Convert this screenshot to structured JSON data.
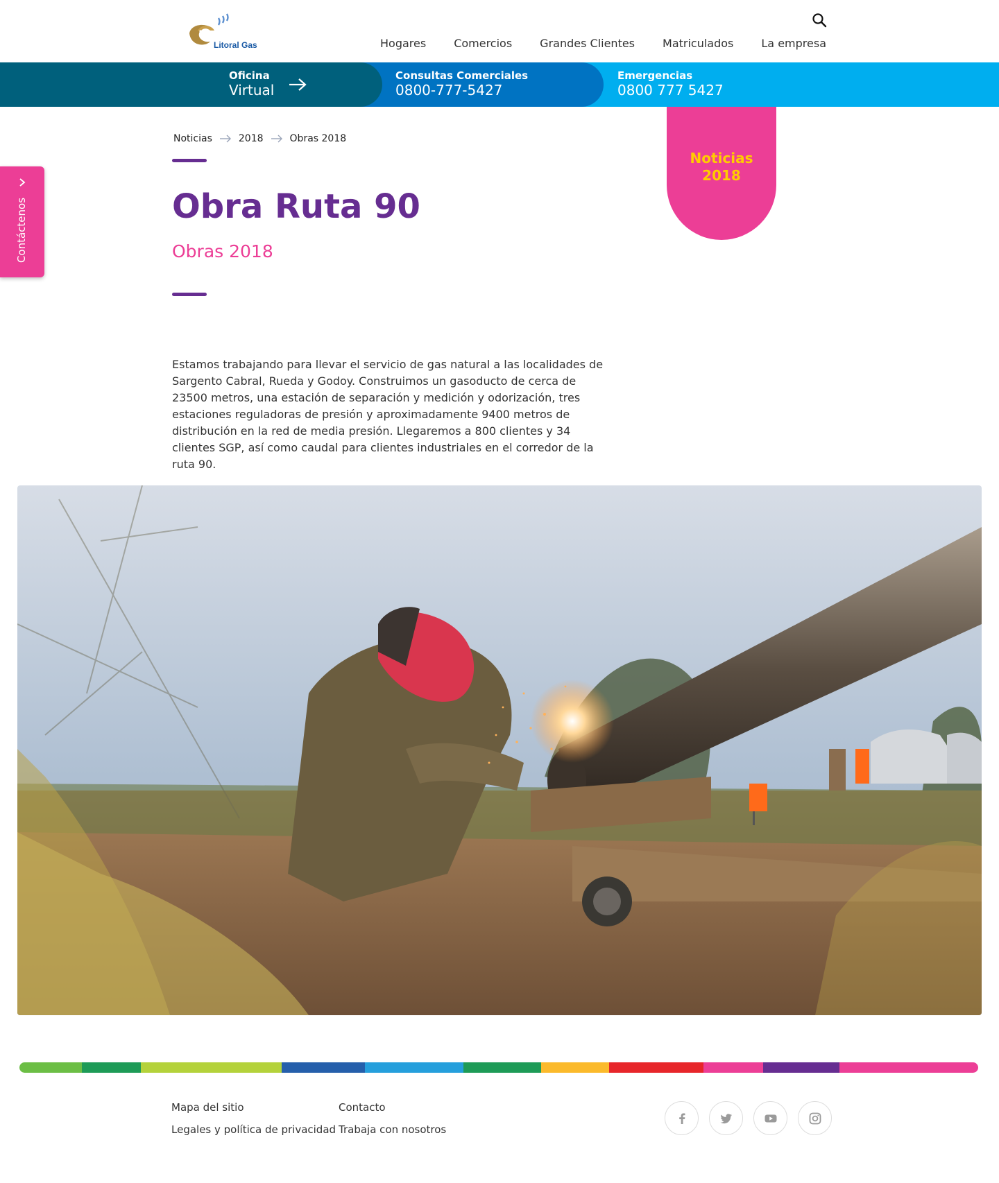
{
  "header": {
    "logo_text": "Litoral Gas",
    "nav": [
      "Hogares",
      "Comercios",
      "Grandes Clientes",
      "Matriculados",
      "La empresa"
    ]
  },
  "banner": {
    "oficina_label": "Oficina",
    "oficina_value": "Virtual",
    "consultas_label": "Consultas Comerciales",
    "consultas_value": "0800-777-5427",
    "emergencias_label": "Emergencias",
    "emergencias_value": "0800 777 5427"
  },
  "contact_tab": {
    "label": "Contáctenos"
  },
  "badge": {
    "text": "Noticias\n2018"
  },
  "breadcrumb": [
    "Noticias",
    "2018",
    "Obras 2018"
  ],
  "article": {
    "title": "Obra Ruta 90",
    "category": "Obras 2018",
    "body": "Estamos trabajando para llevar el servicio de gas natural a las localidades de Sargento Cabral, Rueda y Godoy. Construimos un gasoducto de cerca de 23500 metros, una estación de separación y medición y odorización, tres estaciones reguladoras de presión y aproximadamente 9400 metros de distribución en la red de media presión. Llegaremos a 800 clientes y 34 clientes SGP, así como caudal para clientes industriales en el corredor de la ruta 90."
  },
  "footer": {
    "col1": [
      "Mapa del sitio",
      "Legales y política de privacidad"
    ],
    "col2": [
      "Contacto",
      "Trabaja con nosotros"
    ],
    "social_icons": [
      "facebook-icon",
      "twitter-icon",
      "youtube-icon",
      "instagram-icon"
    ]
  },
  "colors": {
    "purple": "#662d91",
    "pink": "#ec3e96",
    "yellow": "#ffcc00",
    "teal": "#00607c",
    "blue": "#0073c2",
    "cyan": "#00aeef"
  }
}
